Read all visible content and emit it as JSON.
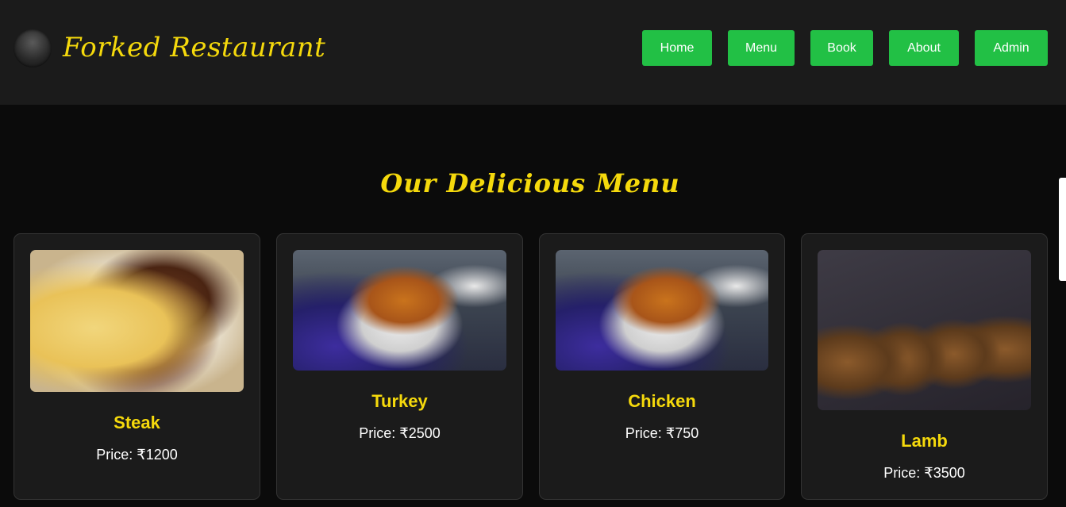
{
  "header": {
    "brand": "Forked Restaurant",
    "logo_icon": "bat-logo-icon",
    "nav": [
      {
        "label": "Home"
      },
      {
        "label": "Menu"
      },
      {
        "label": "Book"
      },
      {
        "label": "About"
      },
      {
        "label": "Admin"
      }
    ]
  },
  "menu": {
    "title": "Our Delicious Menu",
    "items": [
      {
        "name": "Steak",
        "price": "Price: ₹1200",
        "image": "steak-image"
      },
      {
        "name": "Turkey",
        "price": "Price: ₹2500",
        "image": "turkey-image"
      },
      {
        "name": "Chicken",
        "price": "Price: ₹750",
        "image": "chicken-image"
      },
      {
        "name": "Lamb",
        "price": "Price: ₹3500",
        "image": "lamb-image"
      }
    ]
  },
  "colors": {
    "accent_yellow": "#f5d90c",
    "nav_green": "#22c045",
    "header_bg": "#1b1b1b",
    "page_bg": "#0b0b0b"
  }
}
